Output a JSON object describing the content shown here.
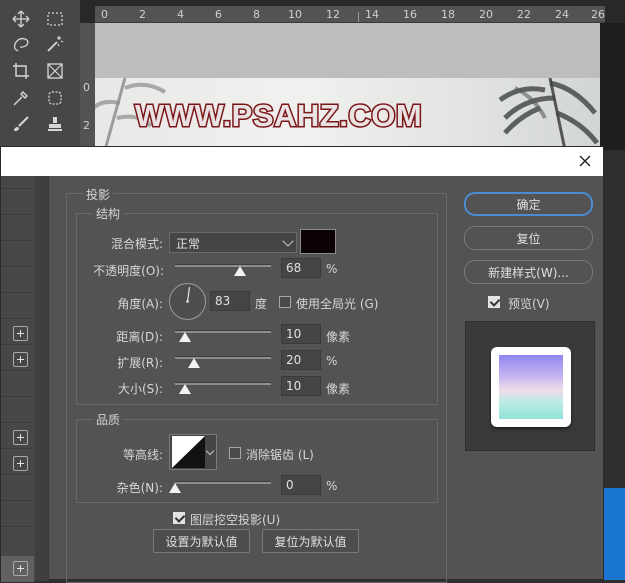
{
  "ruler": {
    "top_numbers": [
      "0",
      "2",
      "4",
      "6",
      "8",
      "10",
      "12",
      "14",
      "16",
      "18",
      "20",
      "22",
      "24",
      "26"
    ],
    "left_numbers": [
      "0",
      "2"
    ]
  },
  "banner": {
    "text": "WWW.PSAHZ.COM"
  },
  "dialog": {
    "shadow_section": {
      "title": "投影"
    },
    "structure": {
      "title": "结构",
      "blend_mode_label": "混合模式:",
      "blend_mode_value": "正常",
      "shadow_color": "#0b0205",
      "opacity_label": "不透明度(O):",
      "opacity_value": "68",
      "opacity_unit": "%",
      "angle_label": "角度(A):",
      "angle_value": "83",
      "angle_unit": "度",
      "global_light_label": "使用全局光 (G)",
      "global_light_checked": false,
      "distance_label": "距离(D):",
      "distance_value": "10",
      "distance_unit": "像素",
      "spread_label": "扩展(R):",
      "spread_value": "20",
      "spread_unit": "%",
      "size_label": "大小(S):",
      "size_value": "10",
      "size_unit": "像素"
    },
    "quality": {
      "title": "品质",
      "contour_label": "等高线:",
      "antialias_label": "消除锯齿 (L)",
      "antialias_checked": false,
      "noise_label": "杂色(N):",
      "noise_value": "0",
      "noise_unit": "%"
    },
    "knockout_label": "图层挖空投影(U)",
    "knockout_checked": true,
    "set_default_label": "设置为默认值",
    "reset_default_label": "复位为默认值",
    "ok_label": "确定",
    "reset_label": "复位",
    "new_style_label": "新建样式(W)...",
    "preview_label": "预览(V)",
    "preview_checked": true
  }
}
